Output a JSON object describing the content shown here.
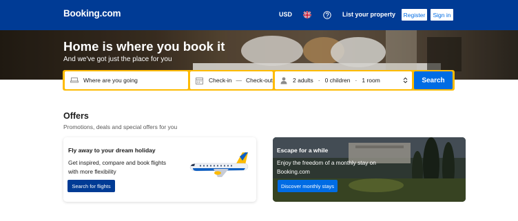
{
  "header": {
    "logo": "Booking.com",
    "currency": "USD",
    "list_property": "List your property",
    "register": "Register",
    "sign_in": "Sign in"
  },
  "hero": {
    "title": "Home is where you book it",
    "subtitle": "And we've got just the place for you"
  },
  "search": {
    "destination_placeholder": "Where are you going",
    "check_in": "Check-in",
    "dash": "—",
    "check_out": "Check-out",
    "adults": "2 adults",
    "children": "0 children",
    "rooms": "1 room",
    "search_button": "Search"
  },
  "offers": {
    "title": "Offers",
    "subtitle": "Promotions, deals and special offers for you",
    "cards": [
      {
        "title": "Fly away to your dream holiday",
        "text_line1": "Get inspired, compare and book flights",
        "text_line2": "with more flexibility",
        "button": "Search for flights"
      },
      {
        "title": "Escape for a while",
        "text_line1": "Enjoy the freedom of a monthly stay on",
        "text_line2": "Booking.com",
        "button": "Discover monthly stays"
      }
    ]
  },
  "colors": {
    "brand_blue": "#003b95",
    "accent_blue": "#006ce4",
    "search_yellow": "#febb02"
  }
}
